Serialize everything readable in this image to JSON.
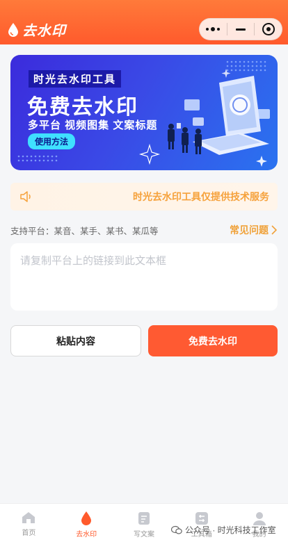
{
  "header": {
    "title": "去水印"
  },
  "banner": {
    "tag": "时光去水印工具",
    "headline": "免费去水印",
    "subline": "多平台 视频图集 文案标题",
    "button": "使用方法"
  },
  "notice": {
    "text": "时光去水印工具仅提供技术服务"
  },
  "support": {
    "platforms": "支持平台：某音、某手、某书、某瓜等",
    "faq": "常见问题"
  },
  "input": {
    "placeholder": "请复制平台上的链接到此文本框",
    "value": ""
  },
  "actions": {
    "paste": "粘贴内容",
    "remove": "免费去水印"
  },
  "tabs": [
    {
      "label": "首页",
      "icon": "home-icon"
    },
    {
      "label": "去水印",
      "icon": "droplet-icon"
    },
    {
      "label": "写文案",
      "icon": "edit-icon"
    },
    {
      "label": "工具箱",
      "icon": "toolbox-icon"
    },
    {
      "label": "我的",
      "icon": "user-icon"
    }
  ],
  "watermark": "公众号 · 时光科技工作室",
  "colors": {
    "primary": "#ff5a2c",
    "notice": "#f6a23c",
    "banner": "#3a49e6"
  }
}
